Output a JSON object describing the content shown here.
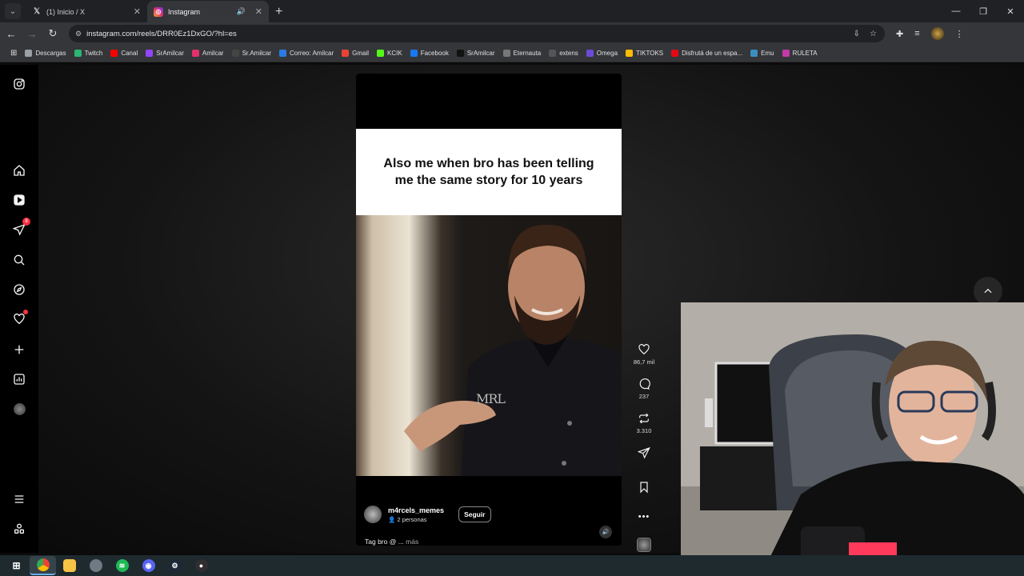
{
  "browser": {
    "tabs": [
      {
        "title": "(1) Inicio / X",
        "favicon": "x-icon",
        "active": false
      },
      {
        "title": "Instagram",
        "favicon": "instagram-icon",
        "active": true
      }
    ],
    "url": "instagram.com/reels/DRR0Ez1DxGO/?hl=es",
    "bookmarks": [
      {
        "label": "Descargas",
        "color": "#9aa0a6"
      },
      {
        "label": "Twitch",
        "color": "#2bb673"
      },
      {
        "label": "Canal",
        "color": "#ff0000"
      },
      {
        "label": "SrAmilcar",
        "color": "#9146ff"
      },
      {
        "label": "Amilcar",
        "color": "#e1306c"
      },
      {
        "label": "Sr.Amilcar",
        "color": "#444444"
      },
      {
        "label": "Correo: Amilcar",
        "color": "#2a7be4"
      },
      {
        "label": "Gmail",
        "color": "#ea4335"
      },
      {
        "label": "KCIK",
        "color": "#53fc18"
      },
      {
        "label": "Facebook",
        "color": "#1877f2"
      },
      {
        "label": "SrAmilcar",
        "color": "#111111"
      },
      {
        "label": "Eternauta",
        "color": "#777777"
      },
      {
        "label": "extens",
        "color": "#555555"
      },
      {
        "label": "Omega",
        "color": "#6d4bd8"
      },
      {
        "label": "TIKTOKS",
        "color": "#fbbc04"
      },
      {
        "label": "Disfrutá de un espa...",
        "color": "#e50914"
      },
      {
        "label": "Emu",
        "color": "#3a8fbf"
      },
      {
        "label": "RULETA",
        "color": "#c23aa8"
      }
    ]
  },
  "reel": {
    "caption": "Also me when bro has been telling me the same story for 10 years",
    "watermark": "MRL",
    "author": "m4rcels_memes",
    "collab": "2 personas",
    "follow_label": "Seguir",
    "description": "Tag bro @ ...",
    "more_label": "más",
    "likes": "86,7 mil",
    "comments": "237",
    "reposts": "3.310",
    "more_dots": "•••"
  },
  "colors": {
    "accent_red": "#ff3040",
    "background": "#000000"
  },
  "sidebar": {
    "notifications_badge": "8"
  }
}
